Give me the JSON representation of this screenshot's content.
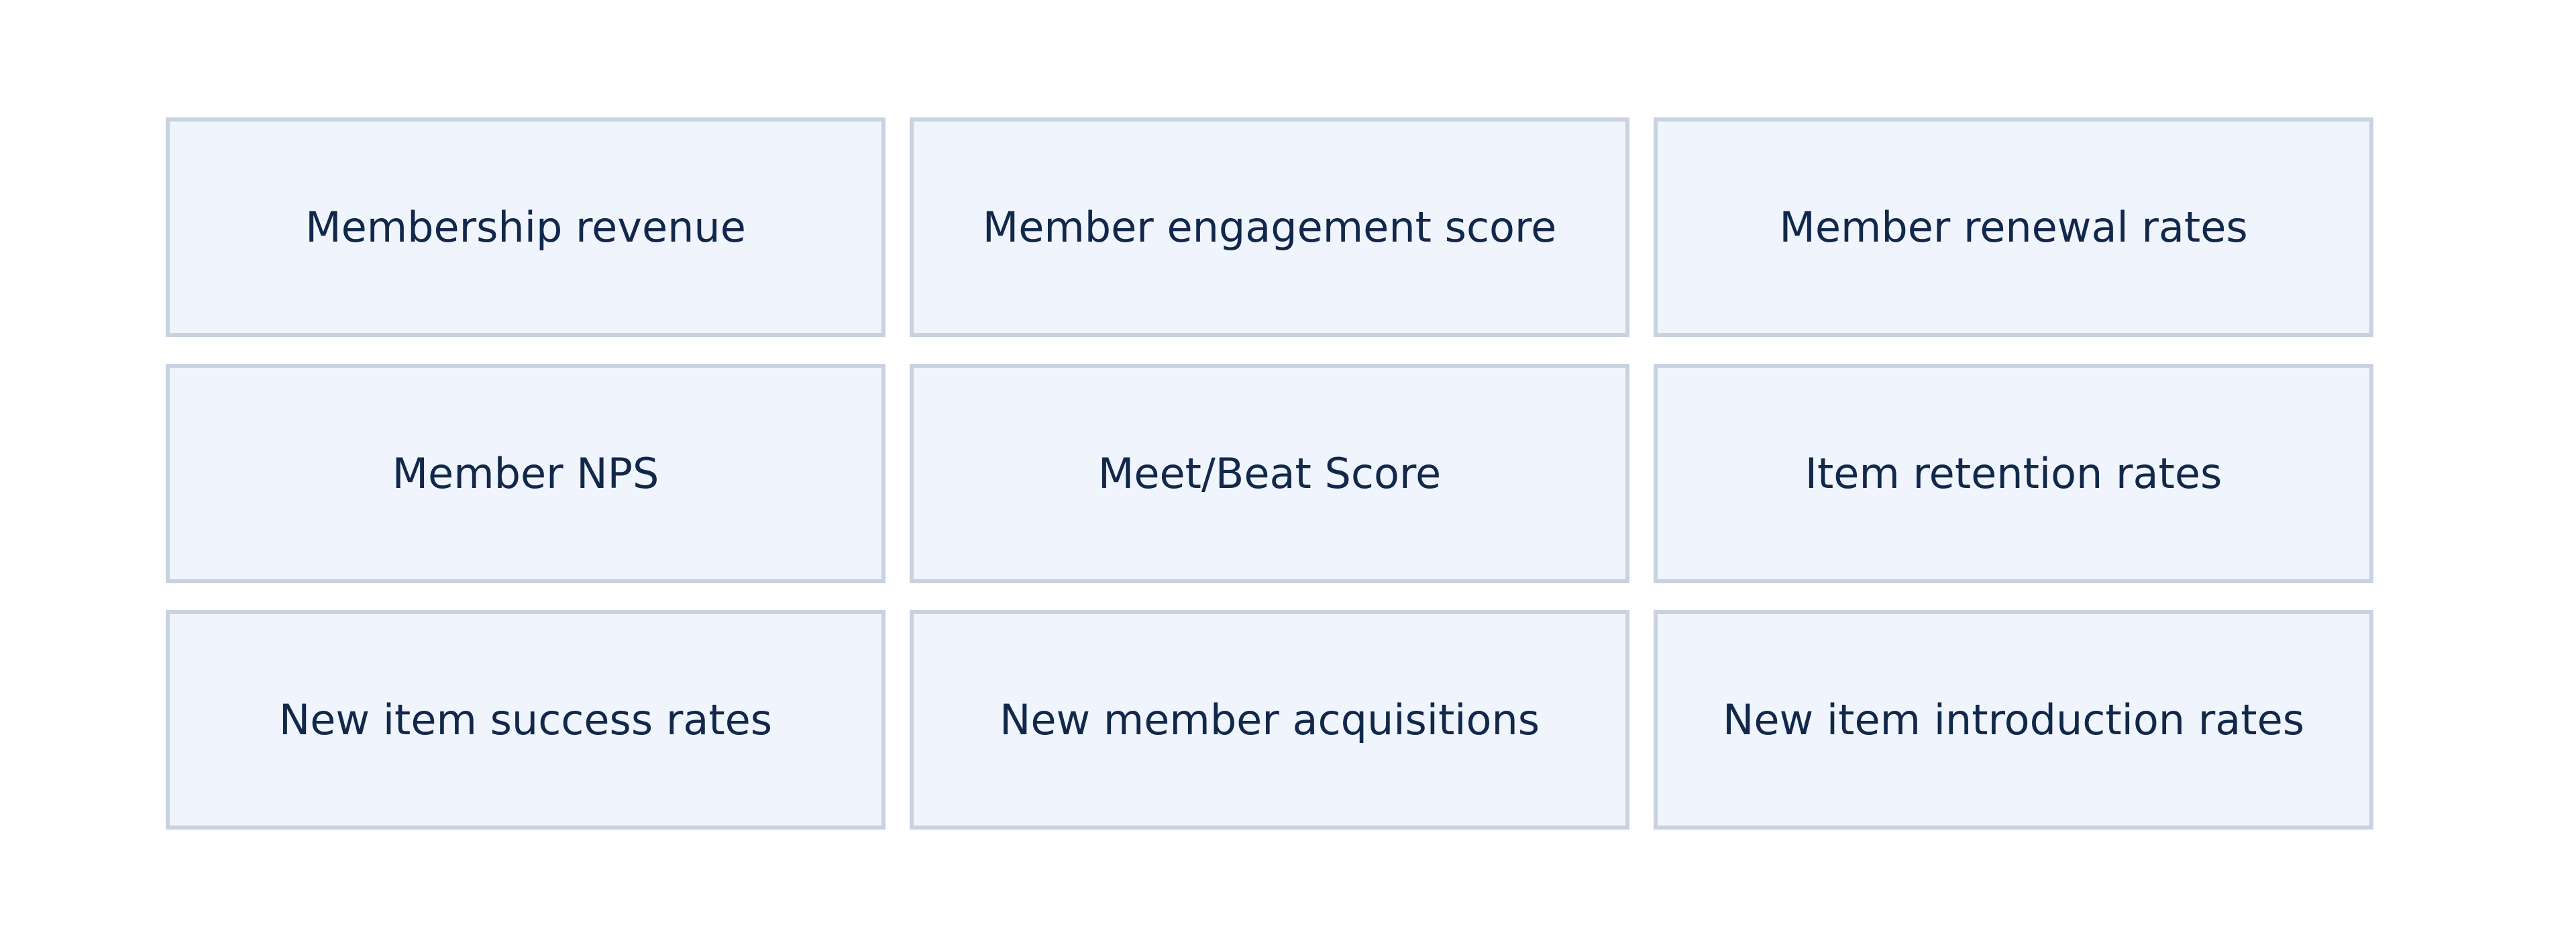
{
  "metrics": {
    "row1": {
      "col1": "Membership revenue",
      "col2": "Member engagement score",
      "col3": "Member renewal rates"
    },
    "row2": {
      "col1": "Member NPS",
      "col2": "Meet/Beat Score",
      "col3": "Item retention rates"
    },
    "row3": {
      "col1": "New item success rates",
      "col2": "New member acquisitions",
      "col3": "New item introduction rates"
    }
  },
  "colors": {
    "card_fill": "#f0f4fc",
    "card_border": "#c8d2e0",
    "text": "#11284b",
    "background": "#ffffff"
  }
}
